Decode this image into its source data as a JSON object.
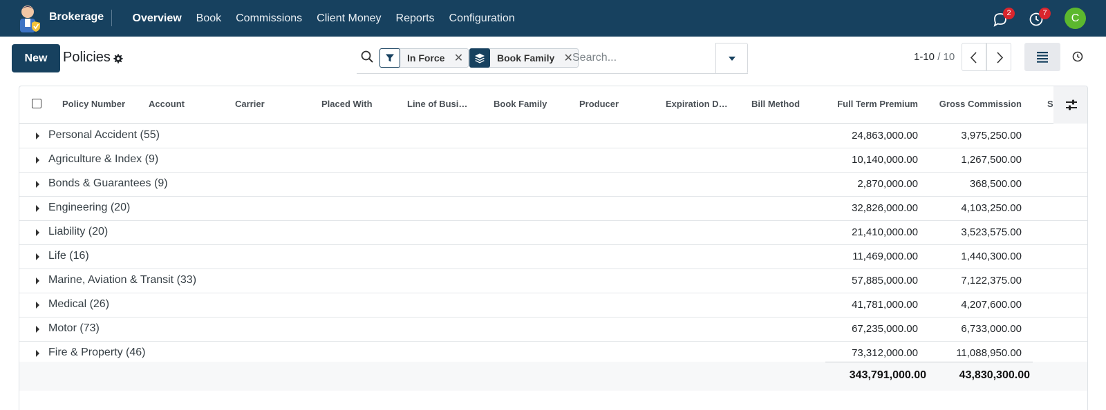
{
  "app": {
    "name": "Brokerage",
    "menu": [
      "Overview",
      "Book",
      "Commissions",
      "Client Money",
      "Reports",
      "Configuration"
    ],
    "active_menu": "Overview",
    "messages_count": "2",
    "activities_count": "7",
    "user_initial": "C",
    "colors": {
      "navbar": "#17415f",
      "avatar": "#5cb82e",
      "badge": "#d9252d"
    }
  },
  "control": {
    "new_label": "New",
    "title": "Policies",
    "filters": [
      {
        "icon": "filter-icon",
        "label": "In Force"
      },
      {
        "icon": "layers-icon",
        "label": "Book Family"
      }
    ],
    "search_placeholder": "Search...",
    "pager_range": "1-10",
    "pager_sep": " / ",
    "pager_total": "10"
  },
  "table": {
    "columns": [
      "Policy Number",
      "Account",
      "Carrier",
      "Placed With",
      "Line of Business",
      "Book Family",
      "Producer",
      "Expiration Date",
      "Bill Method",
      "Full Term Premium",
      "Gross Commission",
      "S"
    ],
    "groups": [
      {
        "name": "Personal Accident (55)",
        "premium": "24,863,000.00",
        "commission": "3,975,250.00"
      },
      {
        "name": "Agriculture & Index (9)",
        "premium": "10,140,000.00",
        "commission": "1,267,500.00"
      },
      {
        "name": "Bonds & Guarantees (9)",
        "premium": "2,870,000.00",
        "commission": "368,500.00"
      },
      {
        "name": "Engineering (20)",
        "premium": "32,826,000.00",
        "commission": "4,103,250.00"
      },
      {
        "name": "Liability (20)",
        "premium": "21,410,000.00",
        "commission": "3,523,575.00"
      },
      {
        "name": "Life (16)",
        "premium": "11,469,000.00",
        "commission": "1,440,300.00"
      },
      {
        "name": "Marine, Aviation & Transit (33)",
        "premium": "57,885,000.00",
        "commission": "7,122,375.00"
      },
      {
        "name": "Medical (26)",
        "premium": "41,781,000.00",
        "commission": "4,207,600.00"
      },
      {
        "name": "Motor (73)",
        "premium": "67,235,000.00",
        "commission": "6,733,000.00"
      },
      {
        "name": "Fire & Property (46)",
        "premium": "73,312,000.00",
        "commission": "11,088,950.00"
      }
    ],
    "totals": {
      "premium": "343,791,000.00",
      "commission": "43,830,300.00"
    }
  }
}
